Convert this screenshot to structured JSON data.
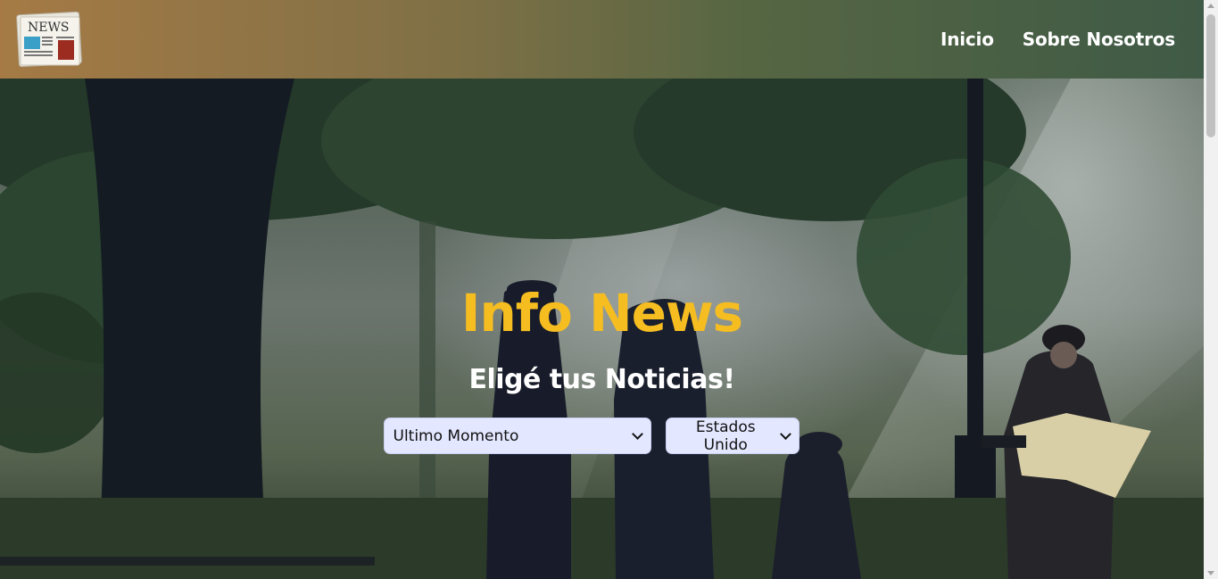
{
  "navbar": {
    "logo_text": "NEWS",
    "links": [
      "Inicio",
      "Sobre Nosotros"
    ]
  },
  "hero": {
    "title": "Info News",
    "subtitle": "Eligé tus Noticias!",
    "category_select": {
      "selected": "Ultimo Momento"
    },
    "country_select": {
      "selected": "Estados Unido"
    }
  },
  "colors": {
    "title": "#f6bd21",
    "select_bg": "#e3e7ff",
    "nav_gradient_start": "#a57a45",
    "nav_gradient_end": "#3f5a46"
  }
}
